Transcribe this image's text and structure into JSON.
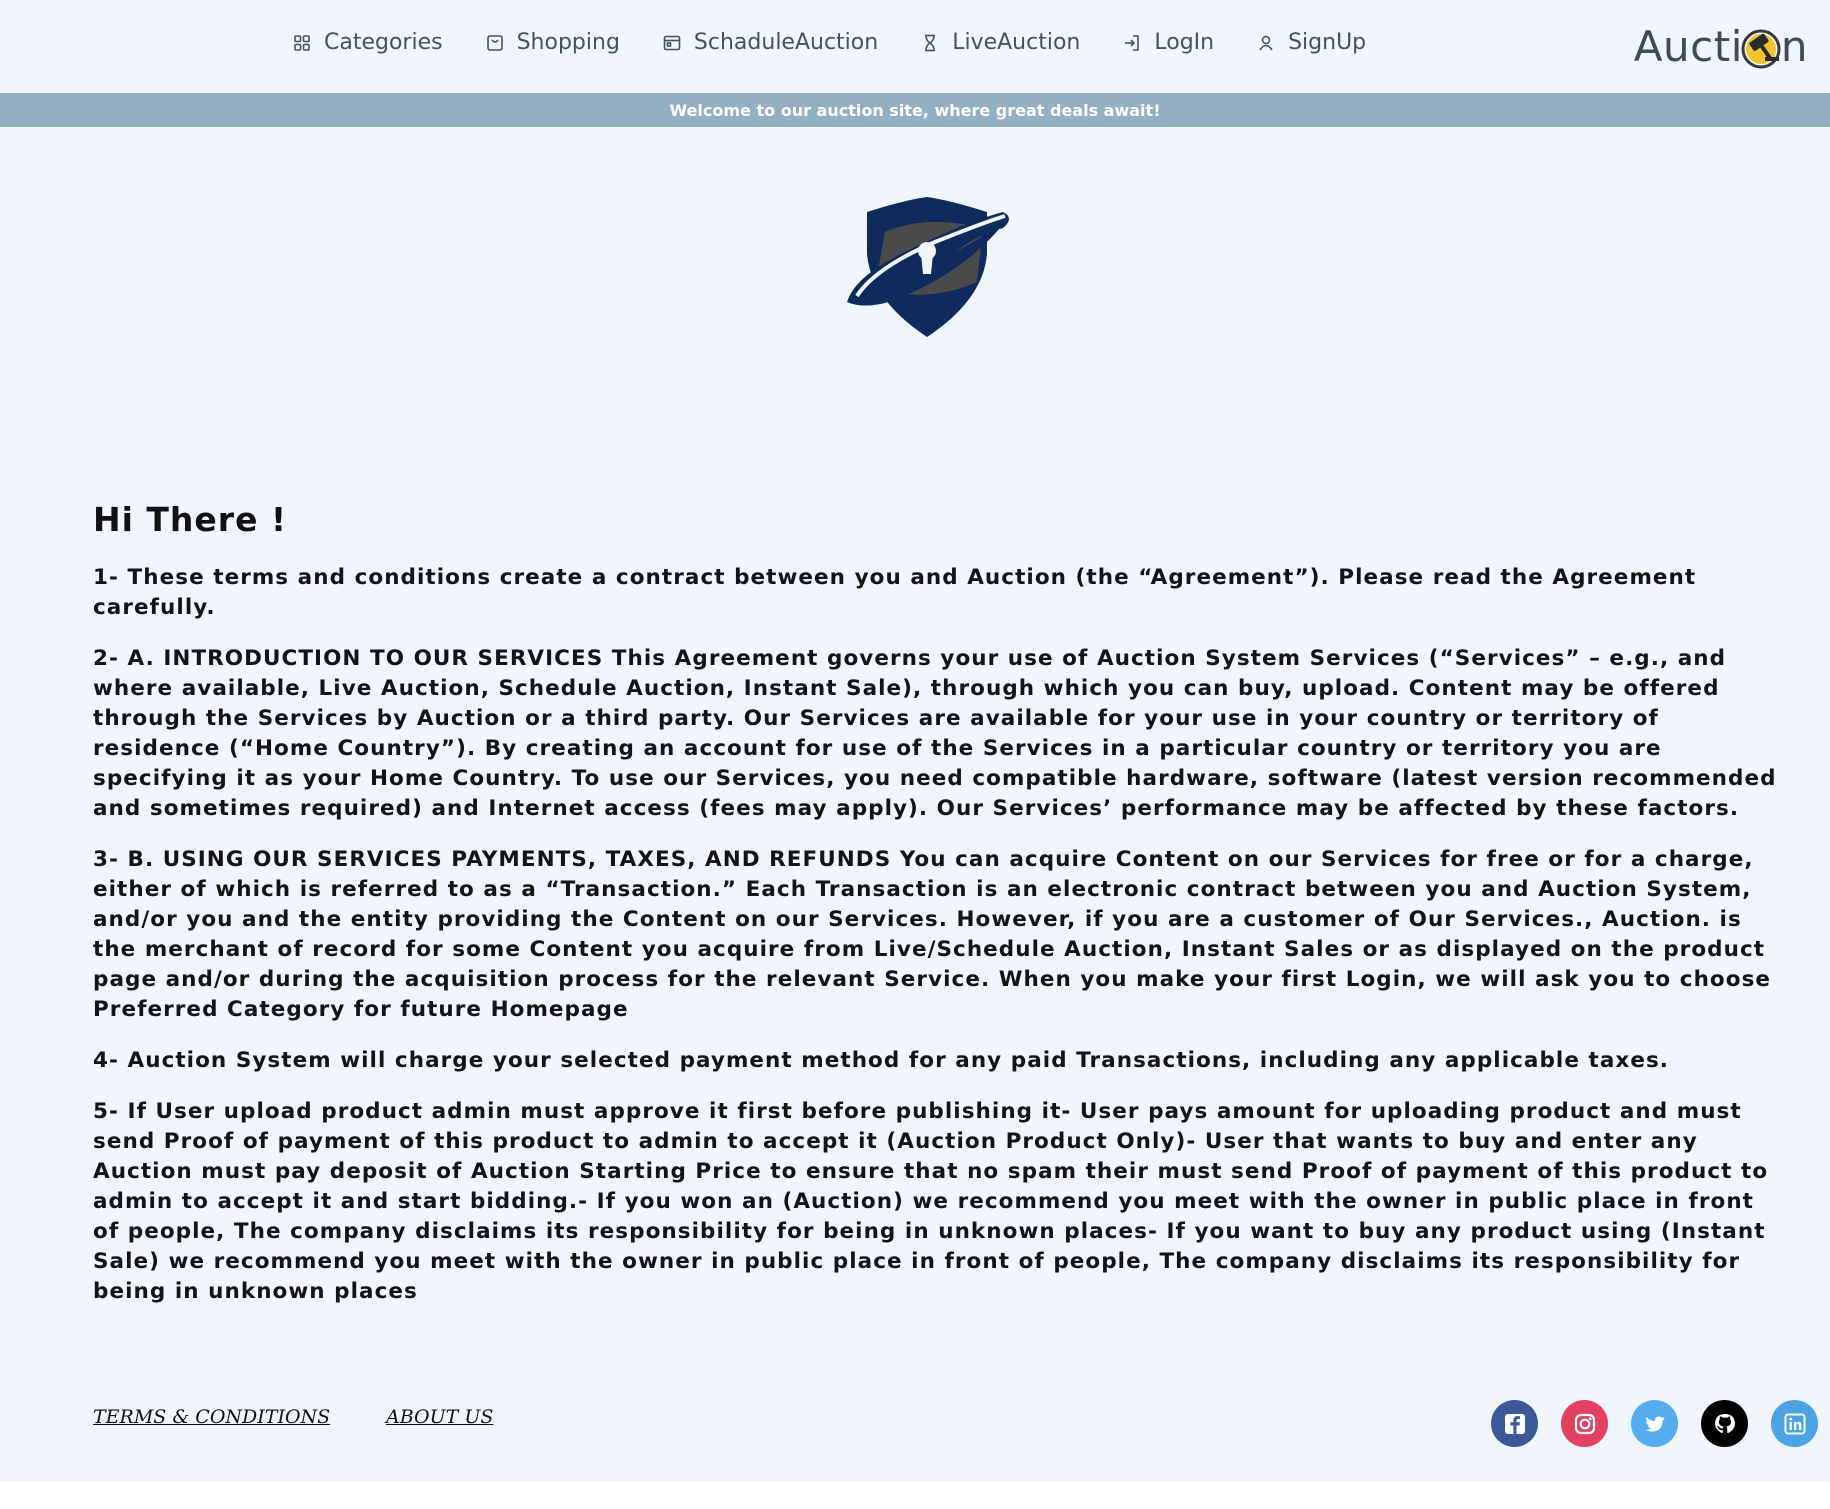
{
  "header": {
    "nav": [
      {
        "label": "Categories",
        "icon": "grid-icon"
      },
      {
        "label": "Shopping",
        "icon": "shopping-bag-icon"
      },
      {
        "label": "SchaduleAuction",
        "icon": "calendar-icon"
      },
      {
        "label": "LiveAuction",
        "icon": "hourglass-icon"
      },
      {
        "label": "LogIn",
        "icon": "login-icon"
      },
      {
        "label": "SignUp",
        "icon": "user-icon"
      }
    ],
    "brand": {
      "text_before": "Aucti",
      "text_after": "n",
      "logo_icon": "gavel-coin-icon"
    }
  },
  "banner": {
    "text": "Welcome to our auction site, where great deals await!"
  },
  "hero": {
    "icon": "shield-lock-icon"
  },
  "main": {
    "heading": "Hi There !",
    "paragraphs": [
      "1- These terms and conditions create a contract between you and Auction (the “Agreement”). Please read the Agreement carefully.",
      "2- A. INTRODUCTION TO OUR SERVICES This Agreement governs your use of Auction System Services (“Services” – e.g., and where available, Live Auction, Schedule Auction, Instant Sale), through which you can buy, upload. Content may be offered through the Services by Auction or a third party. Our Services are available for your use in your country or territory of residence (“Home Country”). By creating an account for use of the Services in a particular country or territory you are specifying it as your Home Country. To use our Services, you need compatible hardware, software (latest version recommended and sometimes required) and Internet access (fees may apply). Our Services’ performance may be affected by these factors.",
      "3- B. USING OUR SERVICES PAYMENTS, TAXES, AND REFUNDS You can acquire Content on our Services for free or for a charge, either of which is referred to as a “Transaction.” Each Transaction is an electronic contract between you and Auction System, and/or you and the entity providing the Content on our Services. However, if you are a customer of Our Services., Auction. is the merchant of record for some Content you acquire from Live/Schedule Auction, Instant Sales or as displayed on the product page and/or during the acquisition process for the relevant Service. When you make your first Login, we will ask you to choose Preferred Category for future Homepage",
      "4- Auction System will charge your selected payment method for any paid Transactions, including any applicable taxes.",
      "5- If User upload product admin must approve it first before publishing it- User pays amount for uploading product and must send Proof of payment of this product to admin to accept it (Auction Product Only)- User that wants to buy and enter any Auction must pay deposit of Auction Starting Price to ensure that no spam their must send Proof of payment of this product to admin to accept it and start bidding.- If you won an (Auction) we recommend you meet with the owner in public place in front of people, The company disclaims its responsibility for being in unknown places- If you want to buy any product using (Instant Sale) we recommend you meet with the owner in public place in front of people, The company disclaims its responsibility for being in unknown places"
    ]
  },
  "footer": {
    "links": [
      "TERMS & CONDITIONS",
      "ABOUT US"
    ],
    "socials": [
      {
        "name": "facebook-icon",
        "color": "#3b5998"
      },
      {
        "name": "instagram-icon",
        "color": "#e4405f"
      },
      {
        "name": "twitter-icon",
        "color": "#55acee"
      },
      {
        "name": "github-icon",
        "color": "#000000"
      },
      {
        "name": "linkedin-icon",
        "color": "#4ba3e3"
      }
    ]
  },
  "colors": {
    "page_bg": "#f0f6fb",
    "banner_bg": "#93b0c3",
    "nav_text": "#45525d",
    "shield_navy": "#0f2a5c",
    "shield_gray": "#4a4a4a",
    "brand_gold": "#f2c230"
  }
}
